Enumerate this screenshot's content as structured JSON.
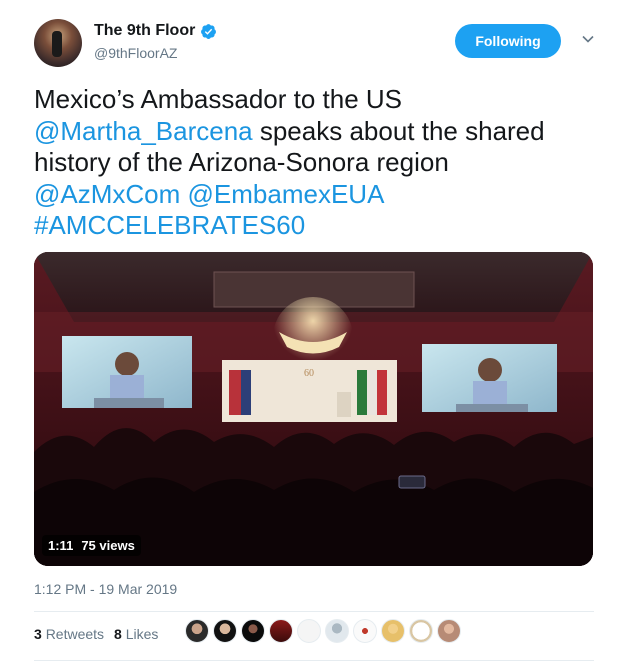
{
  "author": {
    "name": "The 9th Floor",
    "handle": "@9thFloorAZ"
  },
  "follow_button": {
    "label": "Following"
  },
  "tweet": {
    "text_1": "Mexico’s Ambassador to the US",
    "mention_1": "@Martha_Barcena",
    "text_2": " speaks about the shared history of the Arizona-Sonora region",
    "mention_2": "@AzMxCom",
    "mention_3": "@EmbamexEUA",
    "hashtag": "#AMCCELEBRATES60"
  },
  "video": {
    "duration": "1:11",
    "views": "75 views",
    "progress": 0
  },
  "timestamp": "1:12 PM - 19 Mar 2019",
  "engagement": {
    "retweets_count": "3",
    "retweets_label": "Retweets",
    "likes_count": "8",
    "likes_label": "Likes"
  },
  "likers": [
    "avatar-1",
    "avatar-2",
    "avatar-3",
    "avatar-4",
    "avatar-5",
    "avatar-6",
    "avatar-7",
    "avatar-8",
    "avatar-9",
    "avatar-10"
  ],
  "colors": {
    "accent": "#1da1f2",
    "link": "#1b95e0",
    "muted": "#657786",
    "text": "#14171a"
  }
}
